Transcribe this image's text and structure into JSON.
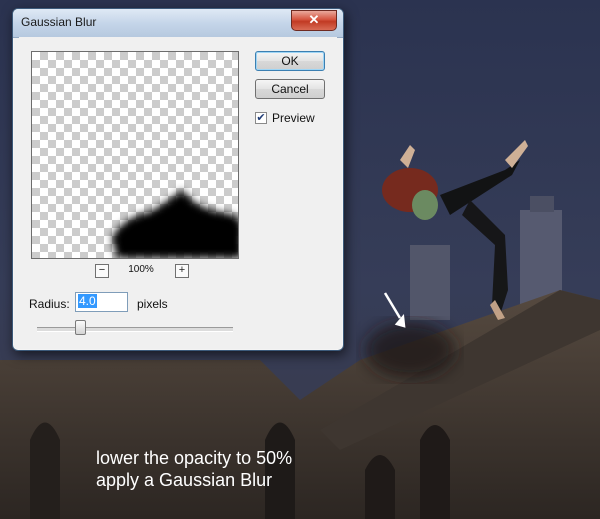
{
  "dialog": {
    "title": "Gaussian Blur",
    "close_glyph": "✕",
    "ok_label": "OK",
    "cancel_label": "Cancel",
    "preview_checked": true,
    "preview_label": "Preview",
    "zoom_out_glyph": "−",
    "zoom_in_glyph": "+",
    "zoom_level": "100%",
    "radius_label": "Radius:",
    "radius_value": "4.0",
    "radius_unit": "pixels"
  },
  "caption": {
    "line1": "lower the opacity to 50%",
    "line2": "apply a Gaussian Blur"
  },
  "colors": {
    "sky": "#2d3550",
    "building": "#4a4038",
    "caption_text": "#ffffff"
  },
  "icons": {
    "close": "close-icon",
    "zoom_out": "minus-icon",
    "zoom_in": "plus-icon",
    "check": "checkmark-icon",
    "arrow": "arrow-icon"
  }
}
